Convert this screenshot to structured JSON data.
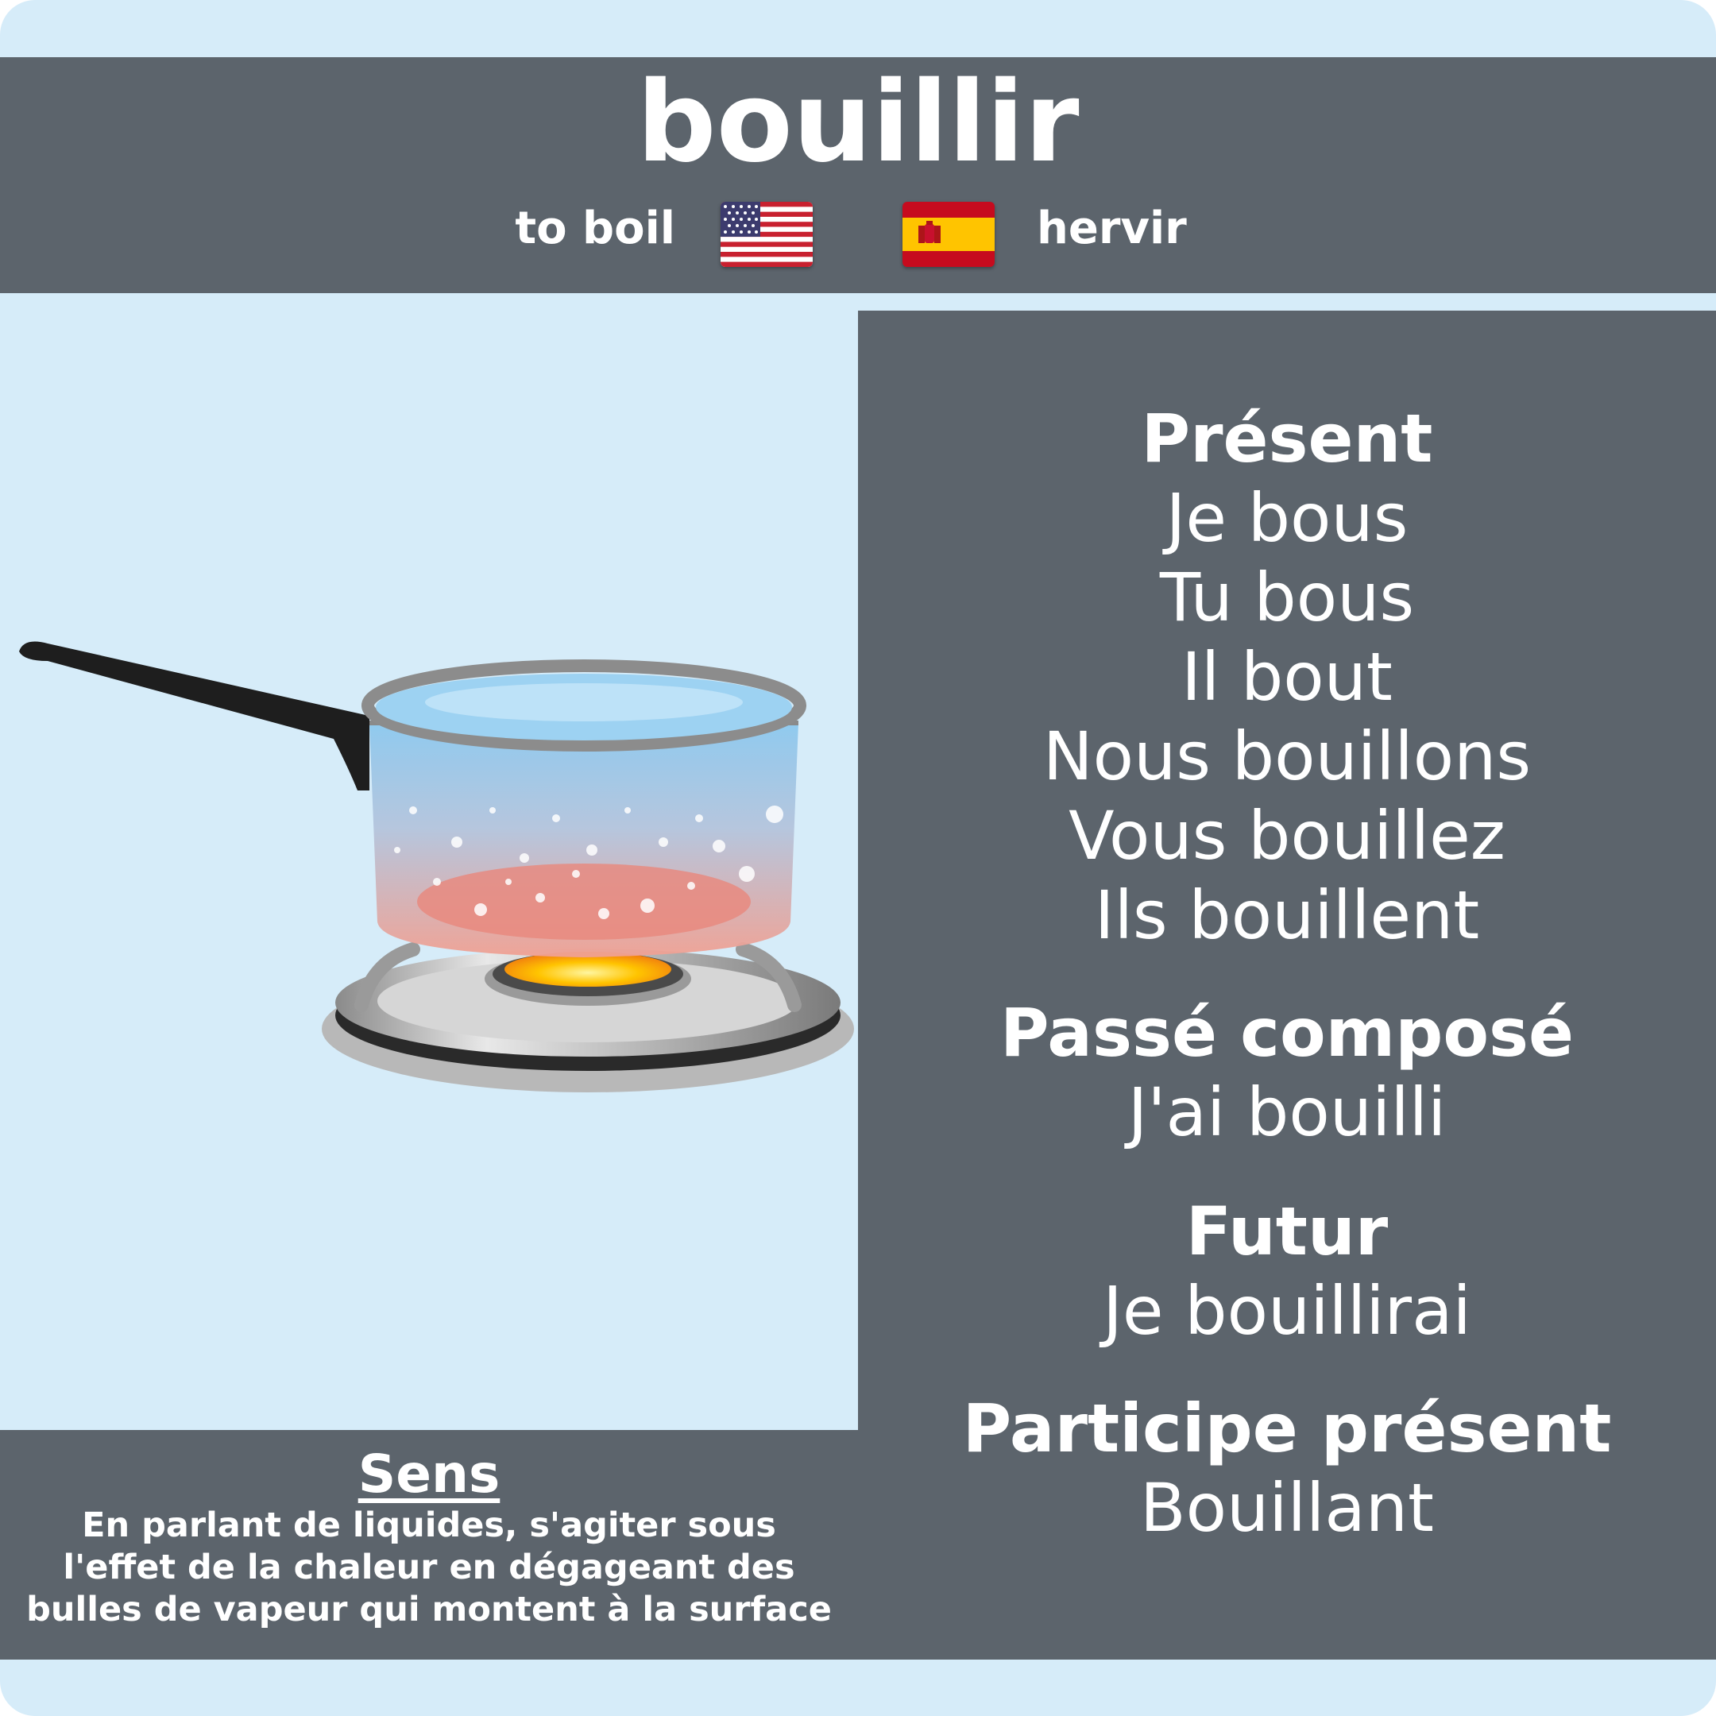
{
  "verb": "bouillir",
  "translations": {
    "english": "to boil",
    "spanish": "hervir"
  },
  "flags": {
    "english": "us-flag-icon",
    "spanish": "spain-flag-icon"
  },
  "illustration": "boiling-pot-on-gas-burner",
  "conjugations": {
    "present": {
      "heading": "Présent",
      "forms": [
        "Je bous",
        "Tu bous",
        "Il bout",
        "Nous bouillons",
        "Vous bouillez",
        "Ils bouillent"
      ]
    },
    "passe_compose": {
      "heading": "Passé composé",
      "form": "J'ai bouilli"
    },
    "futur": {
      "heading": "Futur",
      "form": "Je bouillirai"
    },
    "participe_present": {
      "heading": "Participe présent",
      "form": "Bouillant"
    }
  },
  "sens": {
    "heading": "Sens",
    "lines": [
      "En parlant de liquides, s'agiter sous",
      "l'effet de la chaleur en dégageant des",
      "bulles de vapeur qui montent à la surface"
    ]
  },
  "colors": {
    "background": "#d6ecf9",
    "panel": "#5c646c",
    "text": "#ffffff"
  }
}
